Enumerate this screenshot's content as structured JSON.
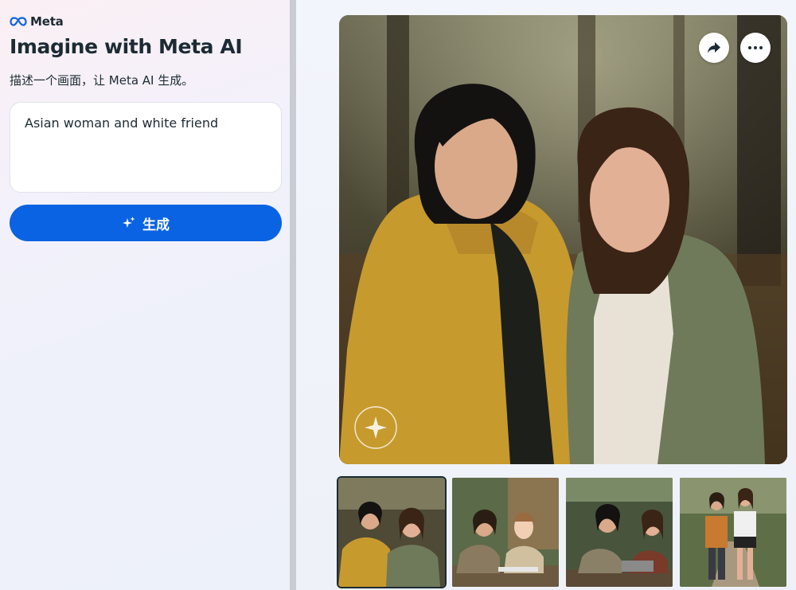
{
  "brand": {
    "logo_text": "Meta"
  },
  "header": {
    "title": "Imagine with Meta AI",
    "subtitle": "描述一个画面，让 Meta AI 生成。"
  },
  "prompt": {
    "value": "Asian woman and white friend"
  },
  "generate_button": {
    "label": "生成"
  },
  "image_actions": {
    "share": "share-icon",
    "more": "more-icon"
  },
  "thumbnails": [
    {
      "id": "thumb-1",
      "selected": true
    },
    {
      "id": "thumb-2",
      "selected": false
    },
    {
      "id": "thumb-3",
      "selected": false
    },
    {
      "id": "thumb-4",
      "selected": false
    }
  ],
  "colors": {
    "accent": "#0a63e2",
    "text": "#1c2b33"
  }
}
